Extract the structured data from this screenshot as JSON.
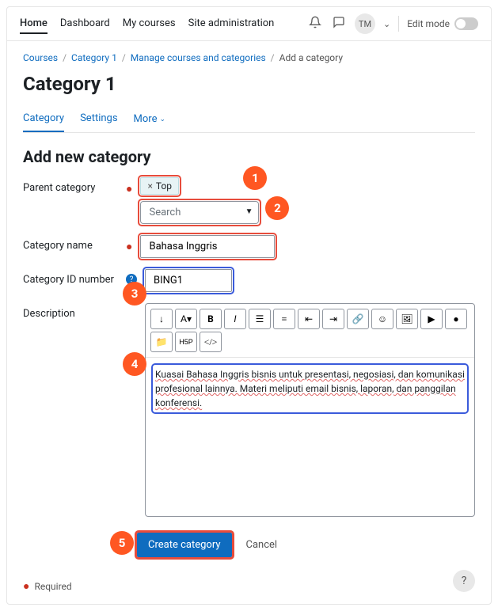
{
  "topnav": {
    "home": "Home",
    "dashboard": "Dashboard",
    "mycourses": "My courses",
    "siteadmin": "Site administration",
    "avatar": "TM",
    "editmode": "Edit mode"
  },
  "breadcrumb": {
    "courses": "Courses",
    "cat1": "Category 1",
    "manage": "Manage courses and categories",
    "current": "Add a category"
  },
  "title": "Category 1",
  "tabs": {
    "category": "Category",
    "settings": "Settings",
    "more": "More"
  },
  "heading": "Add new category",
  "form": {
    "parent_label": "Parent category",
    "parent_tag": "Top",
    "search_placeholder": "Search",
    "name_label": "Category name",
    "name_value": "Bahasa Inggris",
    "id_label": "Category ID number",
    "id_value": "BING1",
    "desc_label": "Description",
    "desc_text": "Kuasai Bahasa Inggris bisnis untuk presentasi, negosiasi, dan komunikasi profesional lainnya. Materi meliputi email bisnis, laporan, dan panggilan konferensi.",
    "create_btn": "Create category",
    "cancel_btn": "Cancel",
    "required": "Required"
  },
  "callouts": {
    "c1": "1",
    "c2": "2",
    "c3": "3",
    "c4": "4",
    "c5": "5"
  }
}
